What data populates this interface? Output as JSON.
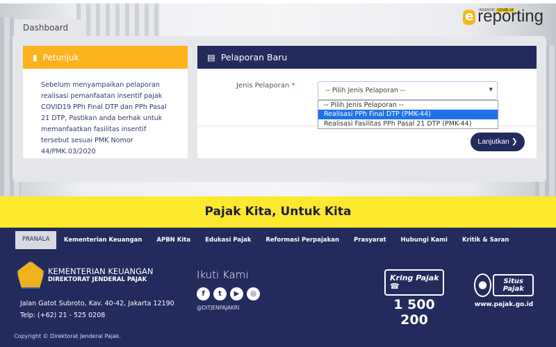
{
  "header": {
    "logo_small": "INSENTIF",
    "logo_badge": "COVID-19",
    "logo_letter": "e",
    "logo_text": "reporting",
    "tab": "Dashboard"
  },
  "petunjuk": {
    "title": "Petunjuk",
    "body": "Sebelum menyampaikan pelaporan realisasi pemanfaatan insentif pajak COVID19 PPh Final DTP dan PPh Pasal 21 DTP, Pastikan anda berhak untuk memanfaatkan fasilitas insentif tersebut sesuai PMK Nomor 44/PMK.03/2020"
  },
  "pelaporan": {
    "title": "Pelaporan Baru",
    "label": "Jenis Pelaporan",
    "required": "*",
    "selected": "-- Pilih Jenis Pelaporan --",
    "options": [
      "-- Pilih Jenis Pelaporan --",
      "Realisasi PPh Final DTP (PMK-44)",
      "Realisasi Fasilitas PPh Pasal 21 DTP (PMK-44)"
    ],
    "highlighted_index": 1,
    "button": "Lanjutkan"
  },
  "slogan": "Pajak Kita, Untuk Kita",
  "footer": {
    "nav": [
      "PRANALA",
      "Kementerian Keuangan",
      "APBN Kita",
      "Edukasi Pajak",
      "Reformasi Perpajakan",
      "Prasyarat",
      "Hubungi Kami",
      "Kritik & Saran"
    ],
    "org1": "KEMENTERIAN KEUANGAN",
    "org2": "DIREKTORAT JENDERAL PAJAK",
    "address": "Jalan Gatot Subroto, Kav. 40-42, Jakarta 12190",
    "phone": "Telp: (+62) 21 - 525 0208",
    "follow": "Ikuti Kami",
    "social": [
      "facebook",
      "twitter",
      "youtube",
      "instagram"
    ],
    "handle": "@DITJENPAJAKRI",
    "kring_label": "Kring Pajak",
    "kring_number": "1 500 200",
    "situs_label": "Situs Pajak",
    "situs_url": "www.pajak.go.id",
    "copyright": "Copyright ©  Direktorat Jenderal Pajak."
  },
  "colors": {
    "navy": "#232a5c",
    "orange": "#fbb21c",
    "yellow": "#fde92d",
    "highlight": "#1e73e8"
  }
}
